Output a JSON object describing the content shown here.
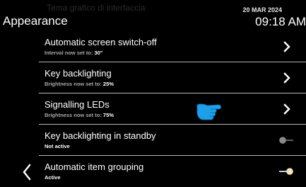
{
  "header": {
    "ghost_title": "Tema grafico di interfaccia",
    "title": "Appearance",
    "date": "20 MAR 2024",
    "time": "09:18 AM"
  },
  "icons": {
    "back": "chevron-left-icon",
    "chevron": "chevron-right-icon",
    "toggle": "toggle-icon",
    "pointer": "pointing-hand-icon"
  },
  "colors": {
    "background": "#000000",
    "divider": "#b8b8b8",
    "subtitle": "#a8a8a8",
    "pointer": "#1e9fe8"
  },
  "rows": [
    {
      "title": "Automatic screen switch-off",
      "sub_prefix": "Interval now set to: ",
      "sub_value": "30\"",
      "control": "chevron"
    },
    {
      "title": "Key backlighting",
      "sub_prefix": "Brightness now set to: ",
      "sub_value": "25%",
      "control": "chevron"
    },
    {
      "title": "Signalling LEDs",
      "sub_prefix": "Brightness now set to: ",
      "sub_value": "75%",
      "control": "chevron"
    },
    {
      "title": "Key backlighting in standby",
      "sub": "Not active",
      "control": "toggle",
      "state": "off"
    },
    {
      "title": "Automatic item grouping",
      "sub": "Active",
      "control": "toggle",
      "state": "on"
    }
  ]
}
